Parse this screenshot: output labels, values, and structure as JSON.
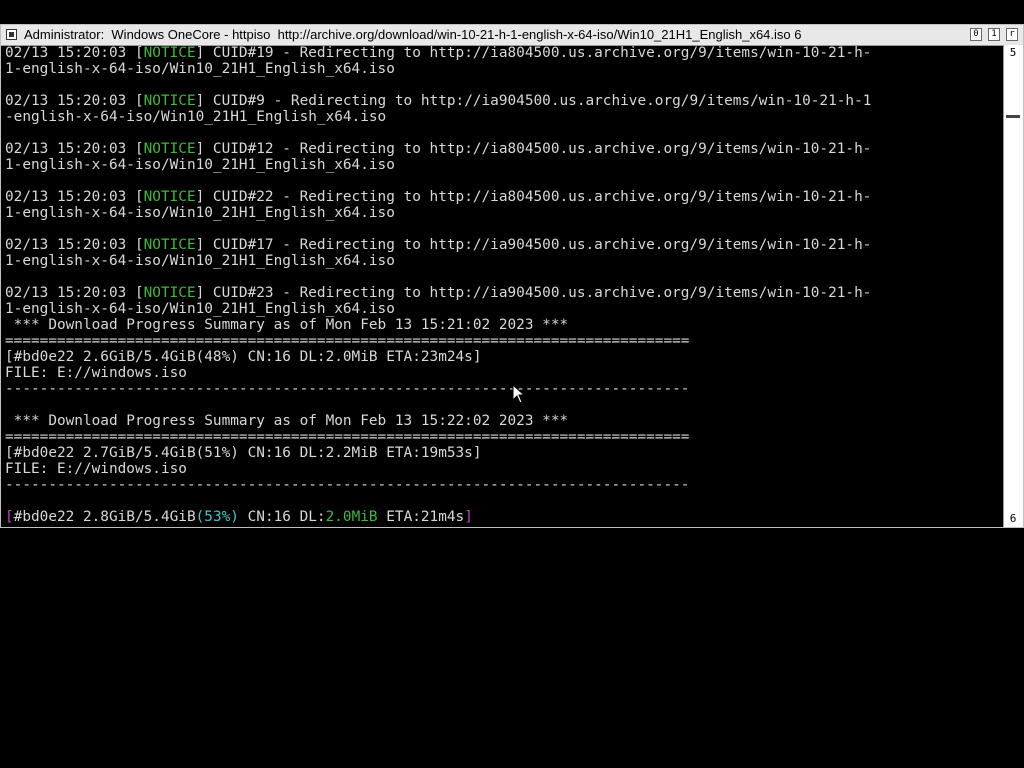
{
  "window": {
    "title": "Administrator:  Windows OneCore - httpiso  http://archive.org/download/win-10-21-h-1-english-x-64-iso/Win10_21H1_English_x64.iso 6",
    "buttons": {
      "minimize": "0",
      "maximize": "1",
      "close": "r"
    }
  },
  "scrollbar": {
    "up": "5",
    "down": "6"
  },
  "terminal": {
    "notices": [
      {
        "prefix": "02/13 15:20:03 [",
        "tag": "NOTICE",
        "rest": "] CUID#19 - Redirecting to http://ia804500.us.archive.org/9/items/win-10-21-h-",
        "cont": "1-english-x-64-iso/Win10_21H1_English_x64.iso"
      },
      {
        "prefix": "02/13 15:20:03 [",
        "tag": "NOTICE",
        "rest": "] CUID#9 - Redirecting to http://ia904500.us.archive.org/9/items/win-10-21-h-1",
        "cont": "-english-x-64-iso/Win10_21H1_English_x64.iso"
      },
      {
        "prefix": "02/13 15:20:03 [",
        "tag": "NOTICE",
        "rest": "] CUID#12 - Redirecting to http://ia804500.us.archive.org/9/items/win-10-21-h-",
        "cont": "1-english-x-64-iso/Win10_21H1_English_x64.iso"
      },
      {
        "prefix": "02/13 15:20:03 [",
        "tag": "NOTICE",
        "rest": "] CUID#22 - Redirecting to http://ia804500.us.archive.org/9/items/win-10-21-h-",
        "cont": "1-english-x-64-iso/Win10_21H1_English_x64.iso"
      },
      {
        "prefix": "02/13 15:20:03 [",
        "tag": "NOTICE",
        "rest": "] CUID#17 - Redirecting to http://ia904500.us.archive.org/9/items/win-10-21-h-",
        "cont": "1-english-x-64-iso/Win10_21H1_English_x64.iso"
      },
      {
        "prefix": "02/13 15:20:03 [",
        "tag": "NOTICE",
        "rest": "] CUID#23 - Redirecting to http://ia904500.us.archive.org/9/items/win-10-21-h-",
        "cont": "1-english-x-64-iso/Win10_21H1_English_x64.iso"
      }
    ],
    "summary1": {
      "header": " *** Download Progress Summary as of Mon Feb 13 15:21:02 2023 ***",
      "equals": "===============================================================================",
      "progress": "[#bd0e22 2.6GiB/5.4GiB(48%) CN:16 DL:2.0MiB ETA:23m24s]",
      "file": "FILE: E://windows.iso",
      "dashes": "-------------------------------------------------------------------------------"
    },
    "summary2": {
      "header": " *** Download Progress Summary as of Mon Feb 13 15:22:02 2023 ***",
      "equals": "===============================================================================",
      "progress": "[#bd0e22 2.7GiB/5.4GiB(51%) CN:16 DL:2.2MiB ETA:19m53s]",
      "file": "FILE: E://windows.iso",
      "dashes": "-------------------------------------------------------------------------------"
    },
    "live": {
      "open": "[",
      "id_size": "#bd0e22 2.8GiB/5.4GiB",
      "percent": "(53%)",
      "cn": " CN:16 DL:",
      "speed": "2.0MiB",
      "eta": " ETA:21m4s",
      "close": "]"
    }
  },
  "colors": {
    "notice": "#3cb83c",
    "bracket": "#c040c0",
    "percent": "#40c8c8",
    "text": "#d8d8d8"
  }
}
